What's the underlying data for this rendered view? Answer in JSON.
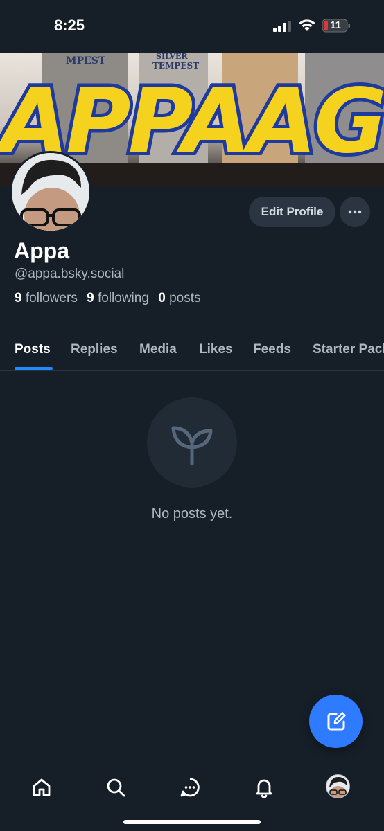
{
  "status_bar": {
    "time": "8:25",
    "battery_level": "11",
    "battery_color": "#e0363b"
  },
  "banner": {
    "text": "APPAAG",
    "box_labels": [
      "MPEST",
      "SILVER",
      "TEMPEST"
    ]
  },
  "profile": {
    "display_name": "Appa",
    "handle": "@appa.bsky.social",
    "edit_profile_label": "Edit Profile",
    "stats": {
      "followers_count": "9",
      "followers_label": "followers",
      "following_count": "9",
      "following_label": "following",
      "posts_count": "0",
      "posts_label": "posts"
    }
  },
  "tabs": [
    {
      "label": "Posts",
      "active": true
    },
    {
      "label": "Replies",
      "active": false
    },
    {
      "label": "Media",
      "active": false
    },
    {
      "label": "Likes",
      "active": false
    },
    {
      "label": "Feeds",
      "active": false
    },
    {
      "label": "Starter Packs",
      "active": false
    }
  ],
  "empty_state": {
    "icon": "seedling-icon",
    "text": "No posts yet."
  },
  "fab": {
    "icon": "compose-icon"
  },
  "bottom_nav": {
    "items": [
      "home-icon",
      "search-icon",
      "chat-icon",
      "bell-icon",
      "profile-avatar"
    ]
  },
  "colors": {
    "background": "#161e27",
    "accent": "#208bfe",
    "fab": "#2f7bff",
    "muted_text": "#aeb8c2"
  }
}
